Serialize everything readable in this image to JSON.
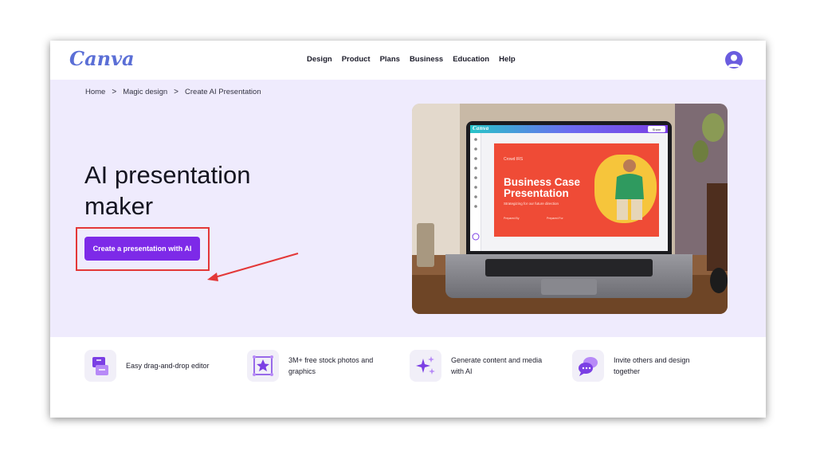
{
  "navbar": {
    "logo": "Canva",
    "links": [
      "Design",
      "Product",
      "Plans",
      "Business",
      "Education",
      "Help"
    ]
  },
  "breadcrumb": {
    "items": [
      "Home",
      "Magic design",
      "Create AI Presentation"
    ],
    "separator": ">"
  },
  "hero": {
    "title_line1": "AI presentation",
    "title_line2": "maker",
    "cta_label": "Create a presentation with AI"
  },
  "hero_image": {
    "app_logo": "Canva",
    "share_label": "Share",
    "slide_brand": "Crowd IRS",
    "slide_title_line1": "Business Case",
    "slide_title_line2": "Presentation",
    "slide_subtitle": "Strategizing for our future direction",
    "slide_foot_left": "Prepared By",
    "slide_foot_right": "Prepared For"
  },
  "features": [
    {
      "icon": "drag-drop-editor-icon",
      "text": "Easy drag-and-drop editor"
    },
    {
      "icon": "stock-photos-icon",
      "text": "3M+ free stock photos and graphics"
    },
    {
      "icon": "sparkles-icon",
      "text": "Generate content and media with AI"
    },
    {
      "icon": "chat-bubbles-icon",
      "text": "Invite others and design together"
    }
  ],
  "colors": {
    "brand_purple": "#7d2ae8",
    "hero_bg": "#efebfd",
    "annotation_red": "#e33838",
    "logo_blue": "#5b6fd6",
    "slide_red": "#ef4b36"
  }
}
